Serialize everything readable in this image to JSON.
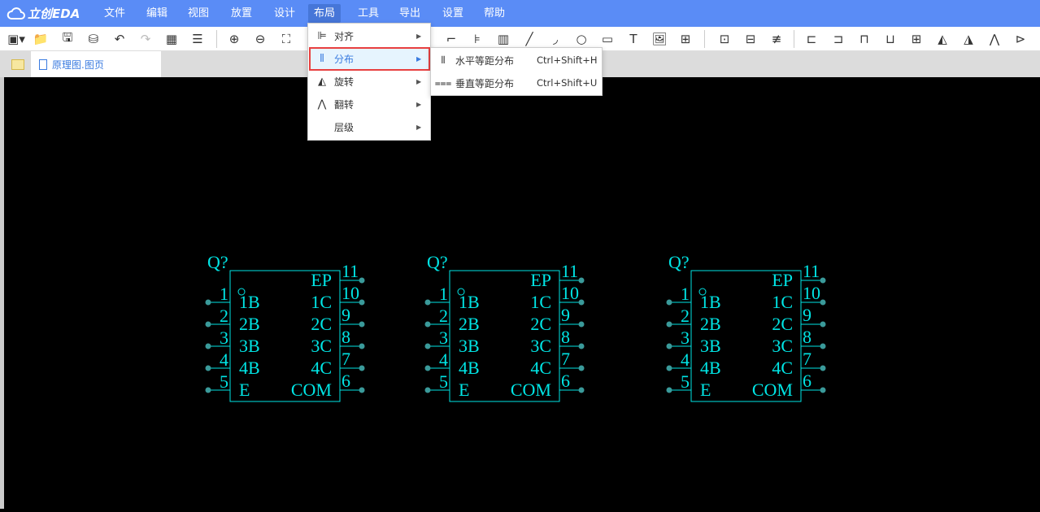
{
  "app": {
    "logo_text": "立创EDA",
    "accent": "#5a8cf6"
  },
  "menubar": [
    {
      "label": "文件"
    },
    {
      "label": "编辑"
    },
    {
      "label": "视图"
    },
    {
      "label": "放置"
    },
    {
      "label": "设计"
    },
    {
      "label": "布局",
      "active": true
    },
    {
      "label": "工具"
    },
    {
      "label": "导出"
    },
    {
      "label": "设置"
    },
    {
      "label": "帮助"
    }
  ],
  "toolbar": [
    {
      "icon": "new-schematic-icon",
      "glyph": "▣▾"
    },
    {
      "icon": "open-folder-icon",
      "glyph": "📁"
    },
    {
      "icon": "save-icon",
      "glyph": "🖫"
    },
    {
      "icon": "save-as-icon",
      "glyph": "⛁"
    },
    {
      "icon": "undo-icon",
      "glyph": "↶"
    },
    {
      "icon": "redo-icon",
      "glyph": "↷",
      "disabled": true
    },
    {
      "icon": "grid-icon",
      "glyph": "▦"
    },
    {
      "icon": "find-icon",
      "glyph": "☰"
    },
    {
      "icon": "zoom-in-icon",
      "glyph": "⊕"
    },
    {
      "icon": "zoom-out-icon",
      "glyph": "⊖"
    },
    {
      "icon": "fit-icon",
      "glyph": "⛶"
    },
    {
      "icon": "wire-icon",
      "glyph": "⌐"
    },
    {
      "icon": "bus-icon",
      "glyph": "⊧"
    },
    {
      "icon": "component-icon",
      "glyph": "▥"
    },
    {
      "icon": "line-icon",
      "glyph": "╱"
    },
    {
      "icon": "arc-icon",
      "glyph": "◞"
    },
    {
      "icon": "circle-icon",
      "glyph": "○"
    },
    {
      "icon": "rectangle-icon",
      "glyph": "▭"
    },
    {
      "icon": "text-icon",
      "glyph": "T"
    },
    {
      "icon": "image-icon",
      "glyph": "🖼"
    },
    {
      "icon": "table-icon",
      "glyph": "⊞"
    },
    {
      "icon": "netlabel-icon",
      "glyph": "⊡"
    },
    {
      "icon": "netport-icon",
      "glyph": "⊟"
    },
    {
      "icon": "no-connect-icon",
      "glyph": "≢"
    },
    {
      "icon": "align-left-icon",
      "glyph": "⊏"
    },
    {
      "icon": "align-right-icon",
      "glyph": "⊐"
    },
    {
      "icon": "align-top-icon",
      "glyph": "⊓"
    },
    {
      "icon": "align-bottom-icon",
      "glyph": "⊔"
    },
    {
      "icon": "align-center-icon",
      "glyph": "⊞"
    },
    {
      "icon": "rotate-left-icon",
      "glyph": "◭"
    },
    {
      "icon": "rotate-right-icon",
      "glyph": "◮"
    },
    {
      "icon": "flip-horizontal-icon",
      "glyph": "⋀"
    },
    {
      "icon": "flip-vertical-icon",
      "glyph": "⊳"
    }
  ],
  "tab": {
    "label": "原理图.图页"
  },
  "layout_menu": {
    "items": [
      {
        "label": "对齐",
        "icon": "align-icon",
        "glyph": "⊫"
      },
      {
        "label": "分布",
        "icon": "distribute-icon",
        "glyph": "⫴",
        "highlighted": true
      },
      {
        "label": "旋转",
        "icon": "rotate-icon",
        "glyph": "◭"
      },
      {
        "label": "翻转",
        "icon": "flip-icon",
        "glyph": "⋀"
      },
      {
        "label": "层级",
        "icon": "",
        "glyph": ""
      }
    ],
    "submenu": [
      {
        "label": "水平等距分布",
        "shortcut": "Ctrl+Shift+H",
        "icon": "distribute-horizontal-icon",
        "glyph": "⫴"
      },
      {
        "label": "垂直等距分布",
        "shortcut": "Ctrl+Shift+U",
        "icon": "distribute-vertical-icon",
        "glyph": "⩶"
      }
    ]
  },
  "canvas": {
    "background": "#000000",
    "symbol_color": "#00e5e5",
    "pin_dot_color": "#3a9a9a",
    "components": [
      {
        "designator": "Q?",
        "left_pins": [
          {
            "num": "1",
            "name": "1B"
          },
          {
            "num": "2",
            "name": "2B"
          },
          {
            "num": "3",
            "name": "3B"
          },
          {
            "num": "4",
            "name": "4B"
          },
          {
            "num": "5",
            "name": "E"
          }
        ],
        "right_pins": [
          {
            "num": "11",
            "name": "EP"
          },
          {
            "num": "10",
            "name": "1C"
          },
          {
            "num": "9",
            "name": "2C"
          },
          {
            "num": "8",
            "name": "3C"
          },
          {
            "num": "7",
            "name": "4C"
          },
          {
            "num": "6",
            "name": "COM"
          }
        ]
      },
      {
        "designator": "Q?",
        "left_pins": [
          {
            "num": "1",
            "name": "1B"
          },
          {
            "num": "2",
            "name": "2B"
          },
          {
            "num": "3",
            "name": "3B"
          },
          {
            "num": "4",
            "name": "4B"
          },
          {
            "num": "5",
            "name": "E"
          }
        ],
        "right_pins": [
          {
            "num": "11",
            "name": "EP"
          },
          {
            "num": "10",
            "name": "1C"
          },
          {
            "num": "9",
            "name": "2C"
          },
          {
            "num": "8",
            "name": "3C"
          },
          {
            "num": "7",
            "name": "4C"
          },
          {
            "num": "6",
            "name": "COM"
          }
        ]
      },
      {
        "designator": "Q?",
        "left_pins": [
          {
            "num": "1",
            "name": "1B"
          },
          {
            "num": "2",
            "name": "2B"
          },
          {
            "num": "3",
            "name": "3B"
          },
          {
            "num": "4",
            "name": "4B"
          },
          {
            "num": "5",
            "name": "E"
          }
        ],
        "right_pins": [
          {
            "num": "11",
            "name": "EP"
          },
          {
            "num": "10",
            "name": "1C"
          },
          {
            "num": "9",
            "name": "2C"
          },
          {
            "num": "8",
            "name": "3C"
          },
          {
            "num": "7",
            "name": "4C"
          },
          {
            "num": "6",
            "name": "COM"
          }
        ]
      }
    ]
  }
}
